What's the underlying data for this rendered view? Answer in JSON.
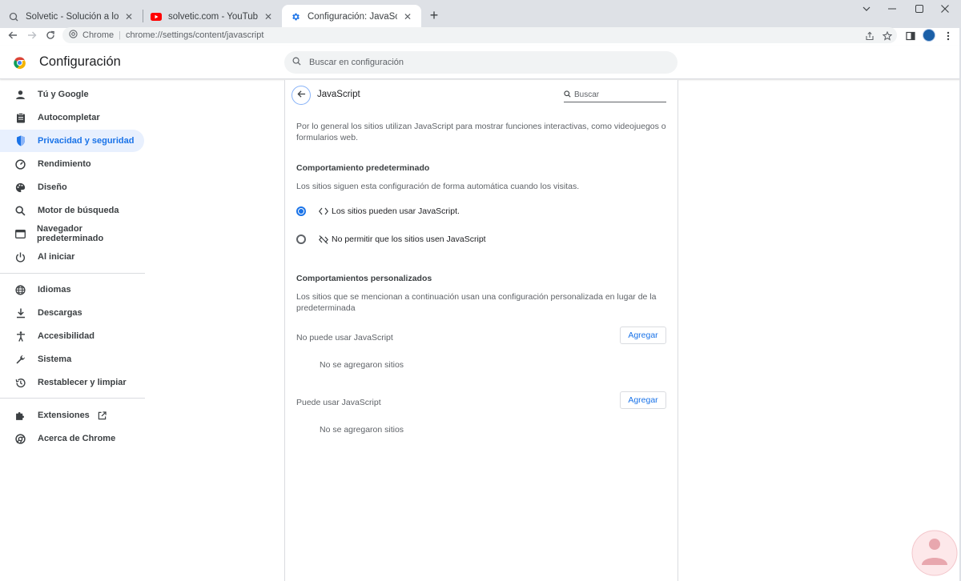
{
  "window": {
    "minimize_icon": "minimize-icon",
    "maximize_icon": "maximize-icon",
    "close_icon": "close-icon",
    "tab_list_icon": "chevron-down-icon"
  },
  "tabs": [
    {
      "title": "Solvetic - Solución a los problem",
      "icon": "solvetic-icon",
      "active": false
    },
    {
      "title": "solvetic.com - YouTube",
      "icon": "youtube-icon",
      "active": false
    },
    {
      "title": "Configuración: JavaScript",
      "icon": "gear-icon",
      "active": true
    }
  ],
  "toolbar": {
    "origin_label": "Chrome",
    "url": "chrome://settings/content/javascript"
  },
  "header": {
    "title": "Configuración",
    "search_placeholder": "Buscar en configuración"
  },
  "sidebar": {
    "items": [
      {
        "label": "Tú y Google",
        "icon": "person-icon",
        "selected": false
      },
      {
        "label": "Autocompletar",
        "icon": "clipboard-icon",
        "selected": false
      },
      {
        "label": "Privacidad y seguridad",
        "icon": "shield-icon",
        "selected": true
      },
      {
        "label": "Rendimiento",
        "icon": "speedometer-icon",
        "selected": false
      },
      {
        "label": "Diseño",
        "icon": "palette-icon",
        "selected": false
      },
      {
        "label": "Motor de búsqueda",
        "icon": "search-icon",
        "selected": false
      },
      {
        "label": "Navegador predeterminado",
        "icon": "browser-icon",
        "selected": false
      },
      {
        "label": "Al iniciar",
        "icon": "power-icon",
        "selected": false
      },
      {
        "label": "Idiomas",
        "icon": "globe-icon",
        "selected": false
      },
      {
        "label": "Descargas",
        "icon": "download-icon",
        "selected": false
      },
      {
        "label": "Accesibilidad",
        "icon": "accessibility-icon",
        "selected": false
      },
      {
        "label": "Sistema",
        "icon": "wrench-icon",
        "selected": false
      },
      {
        "label": "Restablecer y limpiar",
        "icon": "history-icon",
        "selected": false
      },
      {
        "label": "Extensiones",
        "icon": "puzzle-icon",
        "selected": false
      },
      {
        "label": "Acerca de Chrome",
        "icon": "chrome-icon",
        "selected": false
      }
    ]
  },
  "main": {
    "title": "JavaScript",
    "search_placeholder": "Buscar",
    "description_line1": "Por lo general los sitios utilizan JavaScript para mostrar funciones interactivas, como videojuegos o",
    "description_line2": "formularios web.",
    "default_heading": "Comportamiento predeterminado",
    "default_desc": "Los sitios siguen esta configuración de forma automática cuando los visitas.",
    "options": [
      {
        "label": "Los sitios pueden usar JavaScript.",
        "icon": "code-icon",
        "checked": true
      },
      {
        "label": "No permitir que los sitios usen JavaScript",
        "icon": "code-off-icon",
        "checked": false
      }
    ],
    "custom_heading": "Comportamientos personalizados",
    "custom_desc_line1": "Los sitios que se mencionan a continuación usan una configuración personalizada en lugar de la",
    "custom_desc_line2": "predeterminada",
    "blocked_label": "No puede usar JavaScript",
    "allowed_label": "Puede usar JavaScript",
    "add_label": "Agregar",
    "empty_message": "No se agregaron sitios"
  },
  "colors": {
    "accent": "#1a73e8",
    "selected_bg": "#e8f0fe",
    "tabstrip_bg": "#dee1e6"
  }
}
